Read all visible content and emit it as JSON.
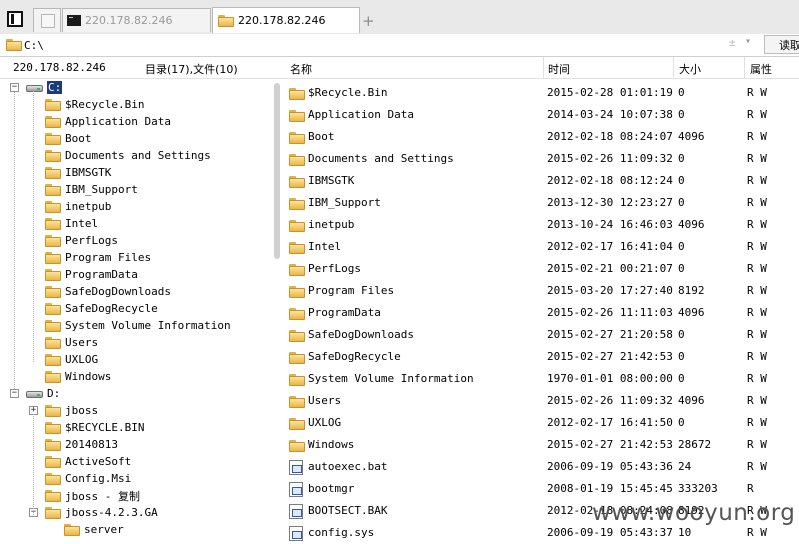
{
  "tabs": [
    {
      "label": ""
    },
    {
      "label": "220.178.82.246"
    },
    {
      "label": "220.178.82.246"
    }
  ],
  "new_tab_label": "+",
  "address": {
    "value": "C:\\",
    "dropdown_glyph": "±",
    "button_label": "读取"
  },
  "info": {
    "host": "220.178.82.246",
    "summary": "目录(17),文件(10)"
  },
  "columns": {
    "name": "名称",
    "time": "时间",
    "size": "大小",
    "attr": "属性"
  },
  "tree": [
    {
      "label": "C:",
      "kind": "drive",
      "level": 0,
      "expander": "−",
      "selected": true
    },
    {
      "label": "$Recycle.Bin",
      "kind": "folder",
      "level": 1
    },
    {
      "label": "Application Data",
      "kind": "folder",
      "level": 1
    },
    {
      "label": "Boot",
      "kind": "folder",
      "level": 1
    },
    {
      "label": "Documents and Settings",
      "kind": "folder",
      "level": 1
    },
    {
      "label": "IBMSGTK",
      "kind": "folder",
      "level": 1
    },
    {
      "label": "IBM_Support",
      "kind": "folder",
      "level": 1
    },
    {
      "label": "inetpub",
      "kind": "folder",
      "level": 1
    },
    {
      "label": "Intel",
      "kind": "folder",
      "level": 1
    },
    {
      "label": "PerfLogs",
      "kind": "folder",
      "level": 1
    },
    {
      "label": "Program Files",
      "kind": "folder",
      "level": 1
    },
    {
      "label": "ProgramData",
      "kind": "folder",
      "level": 1
    },
    {
      "label": "SafeDogDownloads",
      "kind": "folder",
      "level": 1
    },
    {
      "label": "SafeDogRecycle",
      "kind": "folder",
      "level": 1
    },
    {
      "label": "System Volume Information",
      "kind": "folder",
      "level": 1
    },
    {
      "label": "Users",
      "kind": "folder",
      "level": 1
    },
    {
      "label": "UXLOG",
      "kind": "folder",
      "level": 1
    },
    {
      "label": "Windows",
      "kind": "folder",
      "level": 1
    },
    {
      "label": "D:",
      "kind": "drive",
      "level": 0,
      "expander": "−"
    },
    {
      "label": "jboss",
      "kind": "folder",
      "level": 1,
      "expander": "+"
    },
    {
      "label": "$RECYCLE.BIN",
      "kind": "folder",
      "level": 1
    },
    {
      "label": "20140813",
      "kind": "folder",
      "level": 1
    },
    {
      "label": "ActiveSoft",
      "kind": "folder",
      "level": 1
    },
    {
      "label": "Config.Msi",
      "kind": "folder",
      "level": 1
    },
    {
      "label": "jboss - 复制",
      "kind": "folder",
      "level": 1
    },
    {
      "label": "jboss-4.2.3.GA",
      "kind": "folder",
      "level": 1,
      "expander": "−"
    },
    {
      "label": "server",
      "kind": "folder",
      "level": 2
    }
  ],
  "files": [
    {
      "name": "$Recycle.Bin",
      "time": "2015-02-28 01:01:19",
      "size": "0",
      "attr": "R W",
      "type": "folder"
    },
    {
      "name": "Application Data",
      "time": "2014-03-24 10:07:38",
      "size": "0",
      "attr": "R W",
      "type": "folder"
    },
    {
      "name": "Boot",
      "time": "2012-02-18 08:24:07",
      "size": "4096",
      "attr": "R W",
      "type": "folder"
    },
    {
      "name": "Documents and Settings",
      "time": "2015-02-26 11:09:32",
      "size": "0",
      "attr": "R W",
      "type": "folder"
    },
    {
      "name": "IBMSGTK",
      "time": "2012-02-18 08:12:24",
      "size": "0",
      "attr": "R W",
      "type": "folder"
    },
    {
      "name": "IBM_Support",
      "time": "2013-12-30 12:23:27",
      "size": "0",
      "attr": "R W",
      "type": "folder"
    },
    {
      "name": "inetpub",
      "time": "2013-10-24 16:46:03",
      "size": "4096",
      "attr": "R W",
      "type": "folder"
    },
    {
      "name": "Intel",
      "time": "2012-02-17 16:41:04",
      "size": "0",
      "attr": "R W",
      "type": "folder"
    },
    {
      "name": "PerfLogs",
      "time": "2015-02-21 00:21:07",
      "size": "0",
      "attr": "R W",
      "type": "folder"
    },
    {
      "name": "Program Files",
      "time": "2015-03-20 17:27:40",
      "size": "8192",
      "attr": "R W",
      "type": "folder"
    },
    {
      "name": "ProgramData",
      "time": "2015-02-26 11:11:03",
      "size": "4096",
      "attr": "R W",
      "type": "folder"
    },
    {
      "name": "SafeDogDownloads",
      "time": "2015-02-27 21:20:58",
      "size": "0",
      "attr": "R W",
      "type": "folder"
    },
    {
      "name": "SafeDogRecycle",
      "time": "2015-02-27 21:42:53",
      "size": "0",
      "attr": "R W",
      "type": "folder"
    },
    {
      "name": "System Volume Information",
      "time": "1970-01-01 08:00:00",
      "size": "0",
      "attr": "R W",
      "type": "folder"
    },
    {
      "name": "Users",
      "time": "2015-02-26 11:09:32",
      "size": "4096",
      "attr": "R W",
      "type": "folder"
    },
    {
      "name": "UXLOG",
      "time": "2012-02-17 16:41:50",
      "size": "0",
      "attr": "R W",
      "type": "folder"
    },
    {
      "name": "Windows",
      "time": "2015-02-27 21:42:53",
      "size": "28672",
      "attr": "R W",
      "type": "folder"
    },
    {
      "name": "autoexec.bat",
      "time": "2006-09-19 05:43:36",
      "size": "24",
      "attr": "R W",
      "type": "file"
    },
    {
      "name": "bootmgr",
      "time": "2008-01-19 15:45:45",
      "size": "333203",
      "attr": "R",
      "type": "file"
    },
    {
      "name": "BOOTSECT.BAK",
      "time": "2012-02-18 08:24:08",
      "size": "8192",
      "attr": "R W",
      "type": "file"
    },
    {
      "name": "config.sys",
      "time": "2006-09-19 05:43:37",
      "size": "10",
      "attr": "R W",
      "type": "file"
    }
  ],
  "watermark": "www.wooyun.org"
}
